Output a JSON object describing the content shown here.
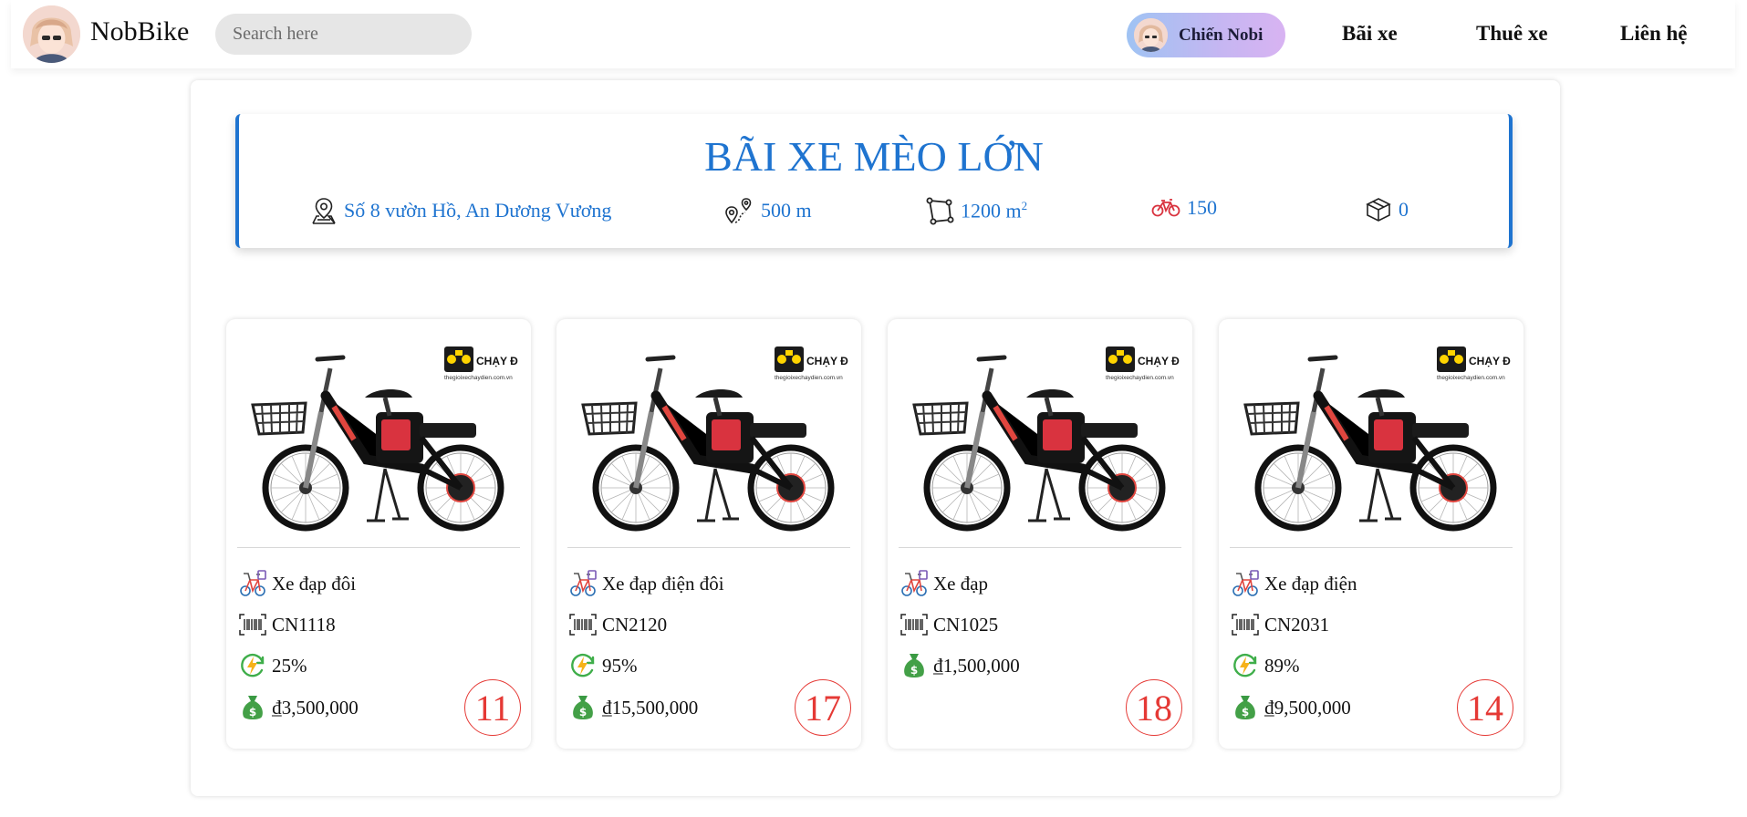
{
  "navbar": {
    "brand": "NobBike",
    "search_placeholder": "Search here",
    "user_name": "Chiến Nobi",
    "links": [
      "Bãi xe",
      "Thuê xe",
      "Liên hệ"
    ]
  },
  "lot": {
    "title": "BÃI XE MÈO LỚN",
    "address": "Số 8 vườn Hồ, An Dương Vương",
    "distance": "500 m",
    "area": "1200 m",
    "area_sup": "2",
    "bike_count": "150",
    "packages": "0",
    "accent": "#1f74d0"
  },
  "bikes": [
    {
      "type": "Xe đạp đôi",
      "code": "CN1118",
      "battery": "25%",
      "price": "₫3,500,000",
      "slot": "11"
    },
    {
      "type": "Xe đạp điện đôi",
      "code": "CN2120",
      "battery": "95%",
      "price": "₫15,500,000",
      "slot": "17"
    },
    {
      "type": "Xe đạp",
      "code": "CN1025",
      "price": "₫1,500,000",
      "slot": "18"
    },
    {
      "type": "Xe đạp điện",
      "code": "CN2031",
      "battery": "89%",
      "price": "₫9,500,000",
      "slot": "14"
    }
  ],
  "image_brand": {
    "name": "CHẠY ĐIỆN",
    "site": "thegioixechaydien.com.vn"
  },
  "colors": {
    "accent": "#1f74d0",
    "badge": "#e53935",
    "money": "#43a047"
  }
}
